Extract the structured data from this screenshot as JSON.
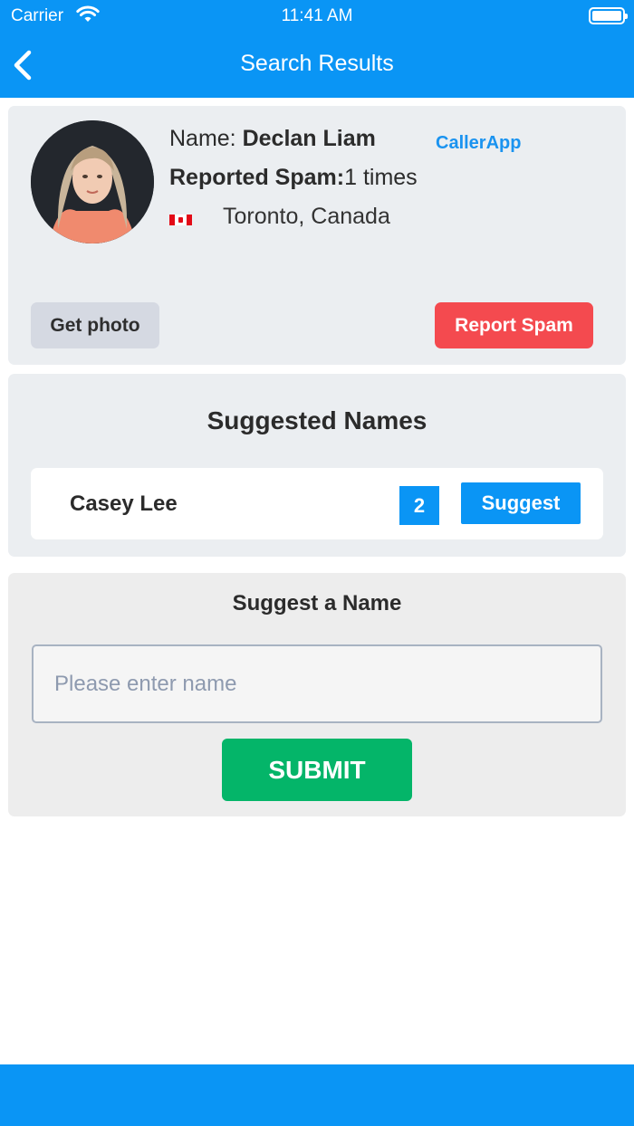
{
  "status_bar": {
    "carrier": "Carrier",
    "time": "11:41 AM"
  },
  "nav": {
    "title": "Search Results"
  },
  "profile": {
    "name_label": "Name: ",
    "name": "Declan Liam",
    "app_tag": "CallerApp",
    "spam_label": "Reported Spam:",
    "spam_value": "1 times",
    "location": "Toronto, Canada",
    "get_photo_label": "Get photo",
    "report_spam_label": "Report Spam"
  },
  "suggested_names": {
    "title": "Suggested Names",
    "items": [
      {
        "name": "Casey Lee",
        "count": "2",
        "button_label": "Suggest"
      }
    ]
  },
  "suggest_form": {
    "title": "Suggest a Name",
    "input_value": "",
    "input_placeholder": "Please enter name",
    "submit_label": "SUBMIT"
  },
  "colors": {
    "primary": "#0a95f5",
    "danger": "#f44a4f",
    "success": "#04b569"
  }
}
